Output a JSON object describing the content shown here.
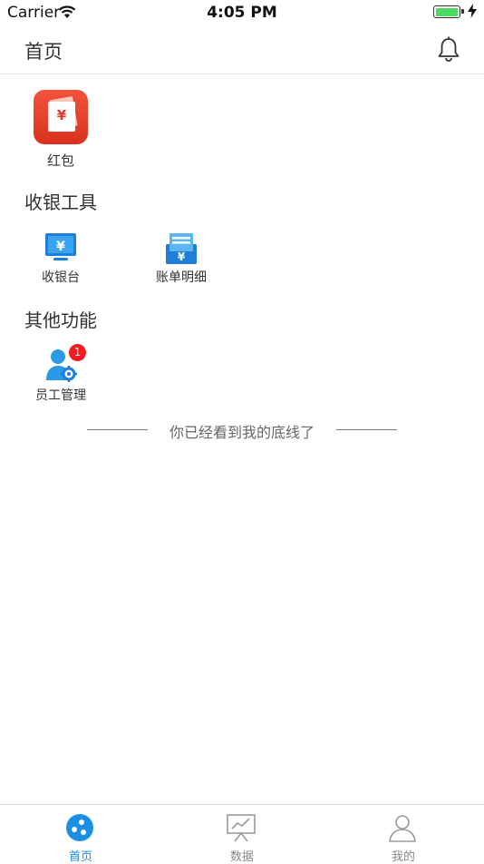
{
  "status_bar": {
    "carrier": "Carrier",
    "time": "4:05 PM"
  },
  "header": {
    "title": "首页"
  },
  "top_items": [
    {
      "label": "红包",
      "icon": "red-envelope-icon"
    }
  ],
  "sections": [
    {
      "title": "收银工具",
      "items": [
        {
          "label": "收银台",
          "icon": "cashier-monitor-icon"
        },
        {
          "label": "账单明细",
          "icon": "bill-detail-icon"
        }
      ]
    },
    {
      "title": "其他功能",
      "items": [
        {
          "label": "员工管理",
          "icon": "staff-management-icon",
          "badge": "1"
        }
      ]
    }
  ],
  "end_text": "你已经看到我的底线了",
  "tabs": [
    {
      "label": "首页",
      "icon": "home-icon",
      "active": true
    },
    {
      "label": "数据",
      "icon": "chart-board-icon",
      "active": false
    },
    {
      "label": "我的",
      "icon": "user-icon",
      "active": false
    }
  ],
  "colors": {
    "accent": "#1a8fe3",
    "hongbao": "#e03a24",
    "badge": "#f01e22"
  }
}
